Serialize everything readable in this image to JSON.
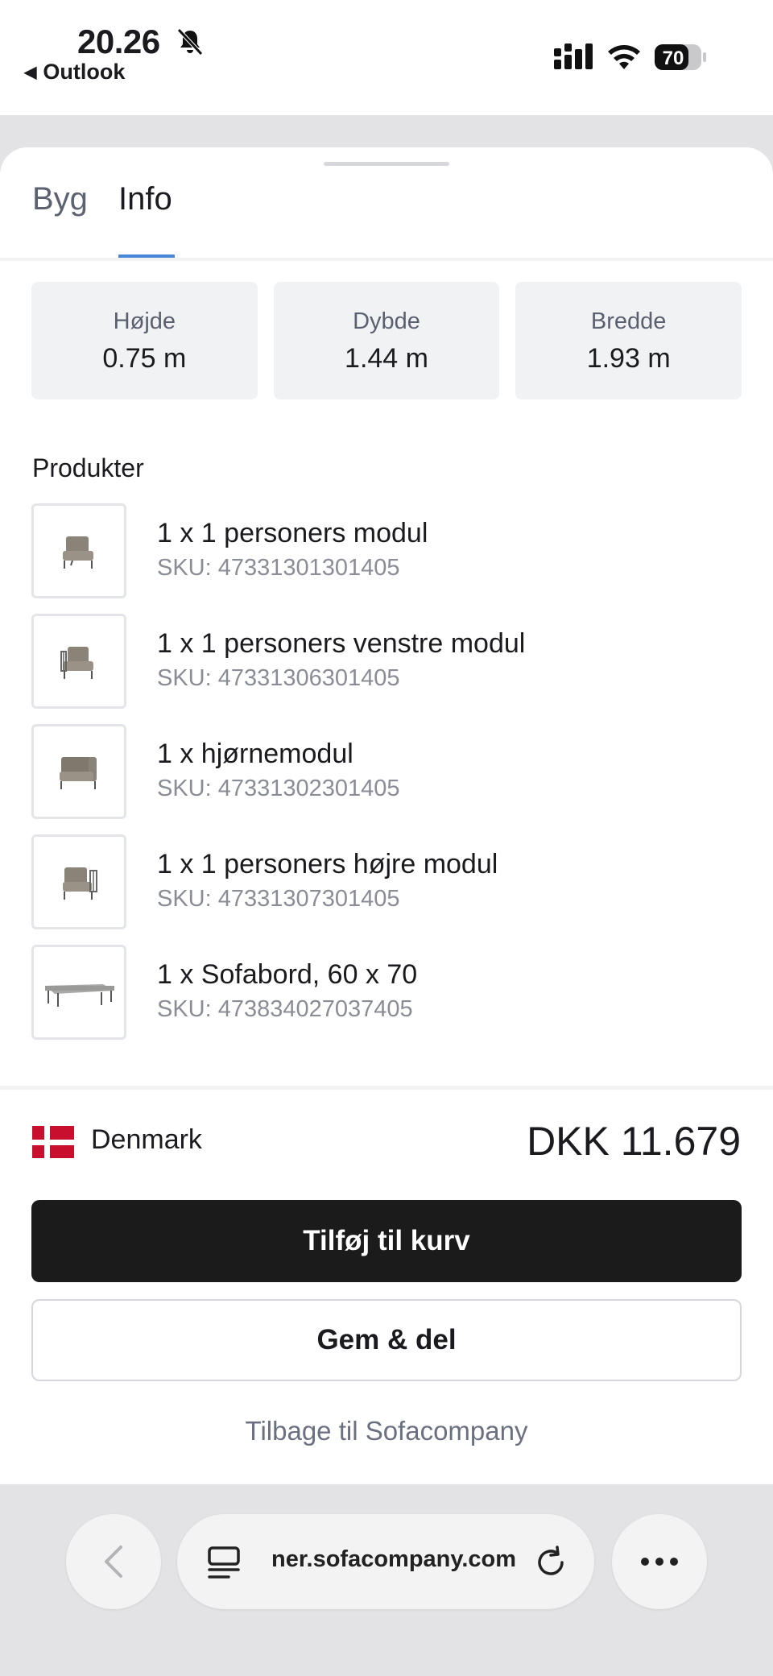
{
  "status": {
    "time": "20.26",
    "back_app": "Outlook",
    "battery": "70"
  },
  "tabs": [
    {
      "label": "Byg"
    },
    {
      "label": "Info"
    }
  ],
  "dimensions": [
    {
      "label": "Højde",
      "value": "0.75 m"
    },
    {
      "label": "Dybde",
      "value": "1.44 m"
    },
    {
      "label": "Bredde",
      "value": "1.93 m"
    }
  ],
  "products_title": "Produkter",
  "products": [
    {
      "name": "1 x 1 personers modul",
      "sku": "SKU: 47331301301405",
      "icon": "chair-module-icon"
    },
    {
      "name": "1 x 1 personers venstre modul",
      "sku": "SKU: 47331306301405",
      "icon": "left-module-icon"
    },
    {
      "name": "1 x hjørnemodul",
      "sku": "SKU: 47331302301405",
      "icon": "corner-module-icon"
    },
    {
      "name": "1 x 1 personers højre modul",
      "sku": "SKU: 47331307301405",
      "icon": "right-module-icon"
    },
    {
      "name": "1 x Sofabord, 60 x 70",
      "sku": "SKU: 473834027037405",
      "icon": "coffee-table-icon"
    }
  ],
  "footer": {
    "country": "Denmark",
    "price": "DKK 11.679",
    "add_to_cart": "Tilføj til kurv",
    "save_share": "Gem & del",
    "back_link": "Tilbage til Sofacompany"
  },
  "browser": {
    "url": "ner.sofacompany.com"
  },
  "colors": {
    "accent": "#4a86d8",
    "primary_button": "#1b1b1b",
    "flag_red": "#c8102e"
  }
}
